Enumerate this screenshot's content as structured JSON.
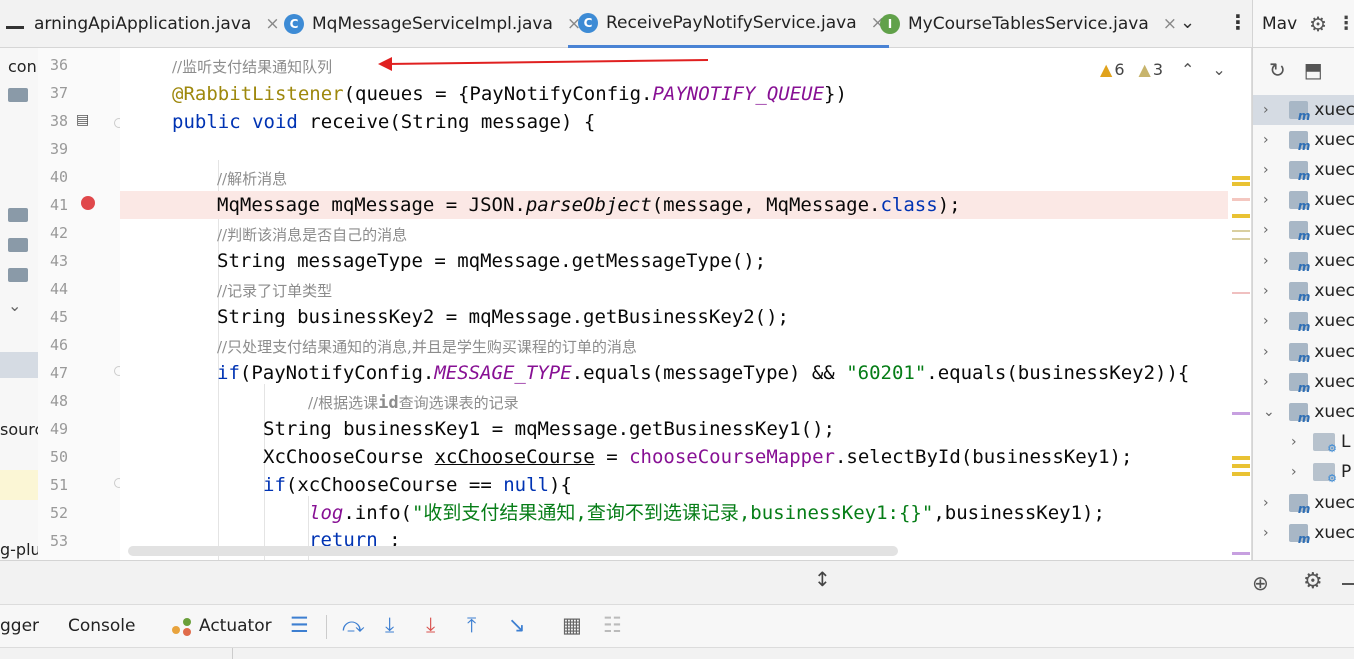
{
  "tabs": [
    {
      "label": "arningApiApplication.java",
      "icon": "none"
    },
    {
      "label": "MqMessageServiceImpl.java",
      "icon": "C"
    },
    {
      "label": "ReceivePayNotifyService.java",
      "icon": "C",
      "active": true
    },
    {
      "label": "MyCourseTablesService.java",
      "icon": "I"
    }
  ],
  "tab_close_glyph": "×",
  "inspections": {
    "warnings": "6",
    "weak_warnings": "3"
  },
  "left_panel": {
    "items": [
      "con",
      "sourc",
      "g-plu"
    ]
  },
  "line_numbers": [
    "36",
    "37",
    "38",
    "39",
    "40",
    "41",
    "42",
    "43",
    "44",
    "45",
    "46",
    "47",
    "48",
    "49",
    "50",
    "51",
    "52",
    "53"
  ],
  "code": {
    "l36": "//监听支付结果通知队列",
    "l37_annotation": "@RabbitListener",
    "l37_a": "(queues = {PayNotifyConfig.",
    "l37_const": "PAYNOTIFY_QUEUE",
    "l37_b": "})",
    "l38_public": "public",
    "l38_void": "void",
    "l38_rest": " receive(String message) {",
    "l40": "//解析消息",
    "l41_a": "MqMessage mqMessage = JSON.",
    "l41_method": "parseObject",
    "l41_b": "(message, MqMessage.",
    "l41_class": "class",
    "l41_c": ");",
    "l42": "//判断该消息是否自己的消息",
    "l43": "String messageType = mqMessage.getMessageType();",
    "l44": "//记录了订单类型",
    "l45": "String businessKey2 = mqMessage.getBusinessKey2();",
    "l46": "//只处理支付结果通知的消息,并且是学生购买课程的订单的消息",
    "l47_if": "if",
    "l47_a": "(PayNotifyConfig.",
    "l47_const": "MESSAGE_TYPE",
    "l47_b": ".equals(messageType) && ",
    "l47_str": "\"60201\"",
    "l47_c": ".equals(businessKey2)){",
    "l48_a": "//根据选课",
    "l48_id": "id",
    "l48_b": "查询选课表的记录",
    "l49": "String businessKey1 = mqMessage.getBusinessKey1();",
    "l50_a": "XcChooseCourse ",
    "l50_var": "xcChooseCourse",
    "l50_b": " = ",
    "l50_field": "chooseCourseMapper",
    "l50_c": ".selectById(businessKey1);",
    "l51_if": "if",
    "l51_a": "(xcChooseCourse == ",
    "l51_null": "null",
    "l51_b": "){",
    "l52_log": "log",
    "l52_a": ".info(",
    "l52_str": "\"收到支付结果通知,查询不到选课记录,businessKey1:{}\"",
    "l52_b": ",businessKey1);",
    "l53_return": "return",
    "l53_a": " ;"
  },
  "maven": {
    "title": "Mav",
    "rows": [
      {
        "label": "xuec",
        "expanded": false,
        "selected": true
      },
      {
        "label": "xuec",
        "expanded": false
      },
      {
        "label": "xuec",
        "expanded": false
      },
      {
        "label": "xuec",
        "expanded": false
      },
      {
        "label": "xuec",
        "expanded": false
      },
      {
        "label": "xuec",
        "expanded": false
      },
      {
        "label": "xuec",
        "expanded": false
      },
      {
        "label": "xuec",
        "expanded": false
      },
      {
        "label": "xuec",
        "expanded": false
      },
      {
        "label": "xuec",
        "expanded": false
      },
      {
        "label": "xuec",
        "expanded": true
      },
      {
        "label": "L",
        "child": true
      },
      {
        "label": "P",
        "child": true
      },
      {
        "label": "xuec",
        "expanded": false
      },
      {
        "label": "xuec",
        "expanded": false
      }
    ]
  },
  "debug_bar": {
    "debugger_label": "gger",
    "console_label": "Console",
    "actuator_label": "Actuator"
  },
  "colors": {
    "breakpoint": "#e0484b",
    "arrow": "#e02020",
    "active_tab": "#4a83d4",
    "highlight_line": "#fbe8e5"
  }
}
